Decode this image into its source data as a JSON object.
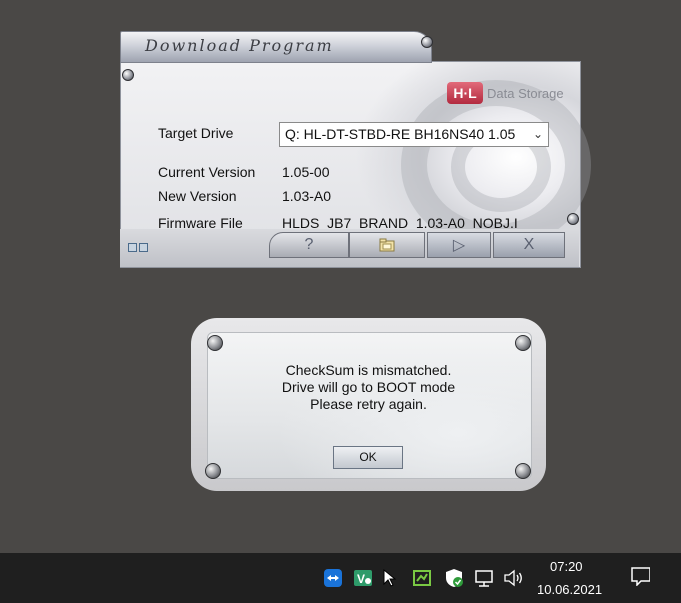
{
  "download_window": {
    "title": "Download Program",
    "brand_mark": "H·L",
    "brand_text": "Data Storage",
    "target_drive_label": "Target Drive",
    "target_drive_value": "Q: HL-DT-STBD-RE  BH16NS40 1.05",
    "current_version_label": "Current Version",
    "current_version_value": "1.05-00",
    "new_version_label": "New Version",
    "new_version_value": "1.03-A0",
    "firmware_file_label": "Firmware File",
    "firmware_file_value": "HLDS_JB7_BRAND_1.03-A0_NOBJ.I",
    "buttons": {
      "help": "?",
      "play": "▷",
      "close": "X"
    }
  },
  "message_dialog": {
    "lines": [
      "CheckSum is mismatched.",
      "Drive will go to BOOT mode",
      "Please retry again."
    ],
    "ok_label": "OK"
  },
  "taskbar": {
    "time": "07:20",
    "date": "10.06.2021",
    "tray_icons": [
      "teamviewer-icon",
      "veeam-icon",
      "cursor-icon",
      "greenshot-icon",
      "security-shield-icon",
      "network-icon",
      "volume-icon",
      "notification-icon"
    ]
  },
  "colors": {
    "desktop": "#4a4846",
    "taskbar": "#1f1f1f",
    "brand": "#c0384b"
  }
}
